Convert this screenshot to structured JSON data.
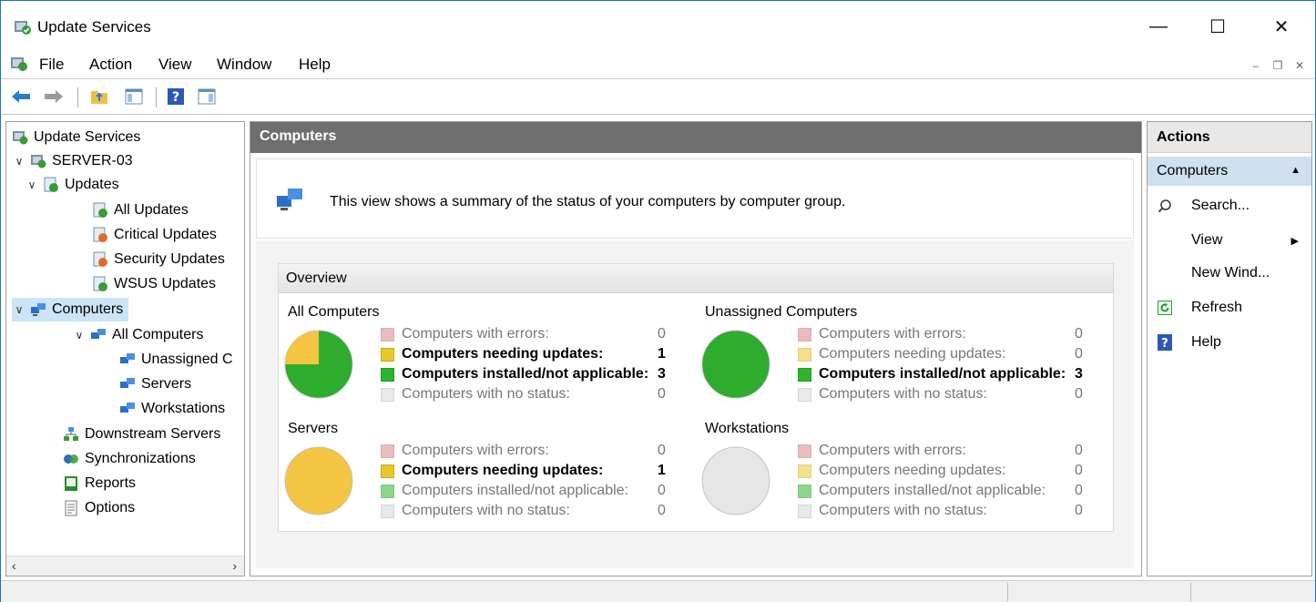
{
  "window": {
    "title": "Update Services"
  },
  "menu": {
    "items": [
      "File",
      "Action",
      "View",
      "Window",
      "Help"
    ]
  },
  "tree": {
    "root": "Update Services",
    "server": "SERVER-03",
    "updates": "Updates",
    "all_updates": "All Updates",
    "critical_updates": "Critical Updates",
    "security_updates": "Security Updates",
    "wsus_updates": "WSUS Updates",
    "computers": "Computers",
    "all_computers": "All Computers",
    "unassigned": "Unassigned C",
    "servers": "Servers",
    "workstations": "Workstations",
    "downstream": "Downstream Servers",
    "synchronizations": "Synchronizations",
    "reports": "Reports",
    "options": "Options"
  },
  "center": {
    "header": "Computers",
    "description": "This view shows a summary of the status of your computers by computer group.",
    "overview_title": "Overview",
    "groups": [
      {
        "title": "All Computers",
        "pie": {
          "green": 3,
          "yellow": 1
        },
        "stats": [
          {
            "label": "Computers with errors:",
            "value": "0",
            "emphasis": false
          },
          {
            "label": "Computers needing updates:",
            "value": "1",
            "emphasis": true
          },
          {
            "label": "Computers installed/not applicable:",
            "value": "3",
            "emphasis": true
          },
          {
            "label": "Computers with no status:",
            "value": "0",
            "emphasis": false
          }
        ]
      },
      {
        "title": "Unassigned Computers",
        "pie": {
          "green": 3,
          "yellow": 0
        },
        "stats": [
          {
            "label": "Computers with errors:",
            "value": "0",
            "emphasis": false
          },
          {
            "label": "Computers needing updates:",
            "value": "0",
            "emphasis": false
          },
          {
            "label": "Computers installed/not applicable:",
            "value": "3",
            "emphasis": true
          },
          {
            "label": "Computers with no status:",
            "value": "0",
            "emphasis": false
          }
        ]
      },
      {
        "title": "Servers",
        "pie": {
          "green": 0,
          "yellow": 1
        },
        "stats": [
          {
            "label": "Computers with errors:",
            "value": "0",
            "emphasis": false
          },
          {
            "label": "Computers needing updates:",
            "value": "1",
            "emphasis": true
          },
          {
            "label": "Computers installed/not applicable:",
            "value": "0",
            "emphasis": false
          },
          {
            "label": "Computers with no status:",
            "value": "0",
            "emphasis": false
          }
        ]
      },
      {
        "title": "Workstations",
        "pie": {
          "green": 0,
          "yellow": 0
        },
        "stats": [
          {
            "label": "Computers with errors:",
            "value": "0",
            "emphasis": false
          },
          {
            "label": "Computers needing updates:",
            "value": "0",
            "emphasis": false
          },
          {
            "label": "Computers installed/not applicable:",
            "value": "0",
            "emphasis": false
          },
          {
            "label": "Computers with no status:",
            "value": "0",
            "emphasis": false
          }
        ]
      }
    ]
  },
  "actions": {
    "header": "Actions",
    "section": "Computers",
    "items": [
      "Search...",
      "View",
      "New Wind...",
      "Refresh",
      "Help"
    ]
  },
  "colors": {
    "errors": "#d9868a",
    "needing": "#e8c92a",
    "installed": "#2bb52b",
    "nostatus": "#d8d8d8",
    "pie_green": "#2eac2e",
    "pie_yellow": "#f4c542",
    "pie_gray": "#e6e6e6"
  }
}
